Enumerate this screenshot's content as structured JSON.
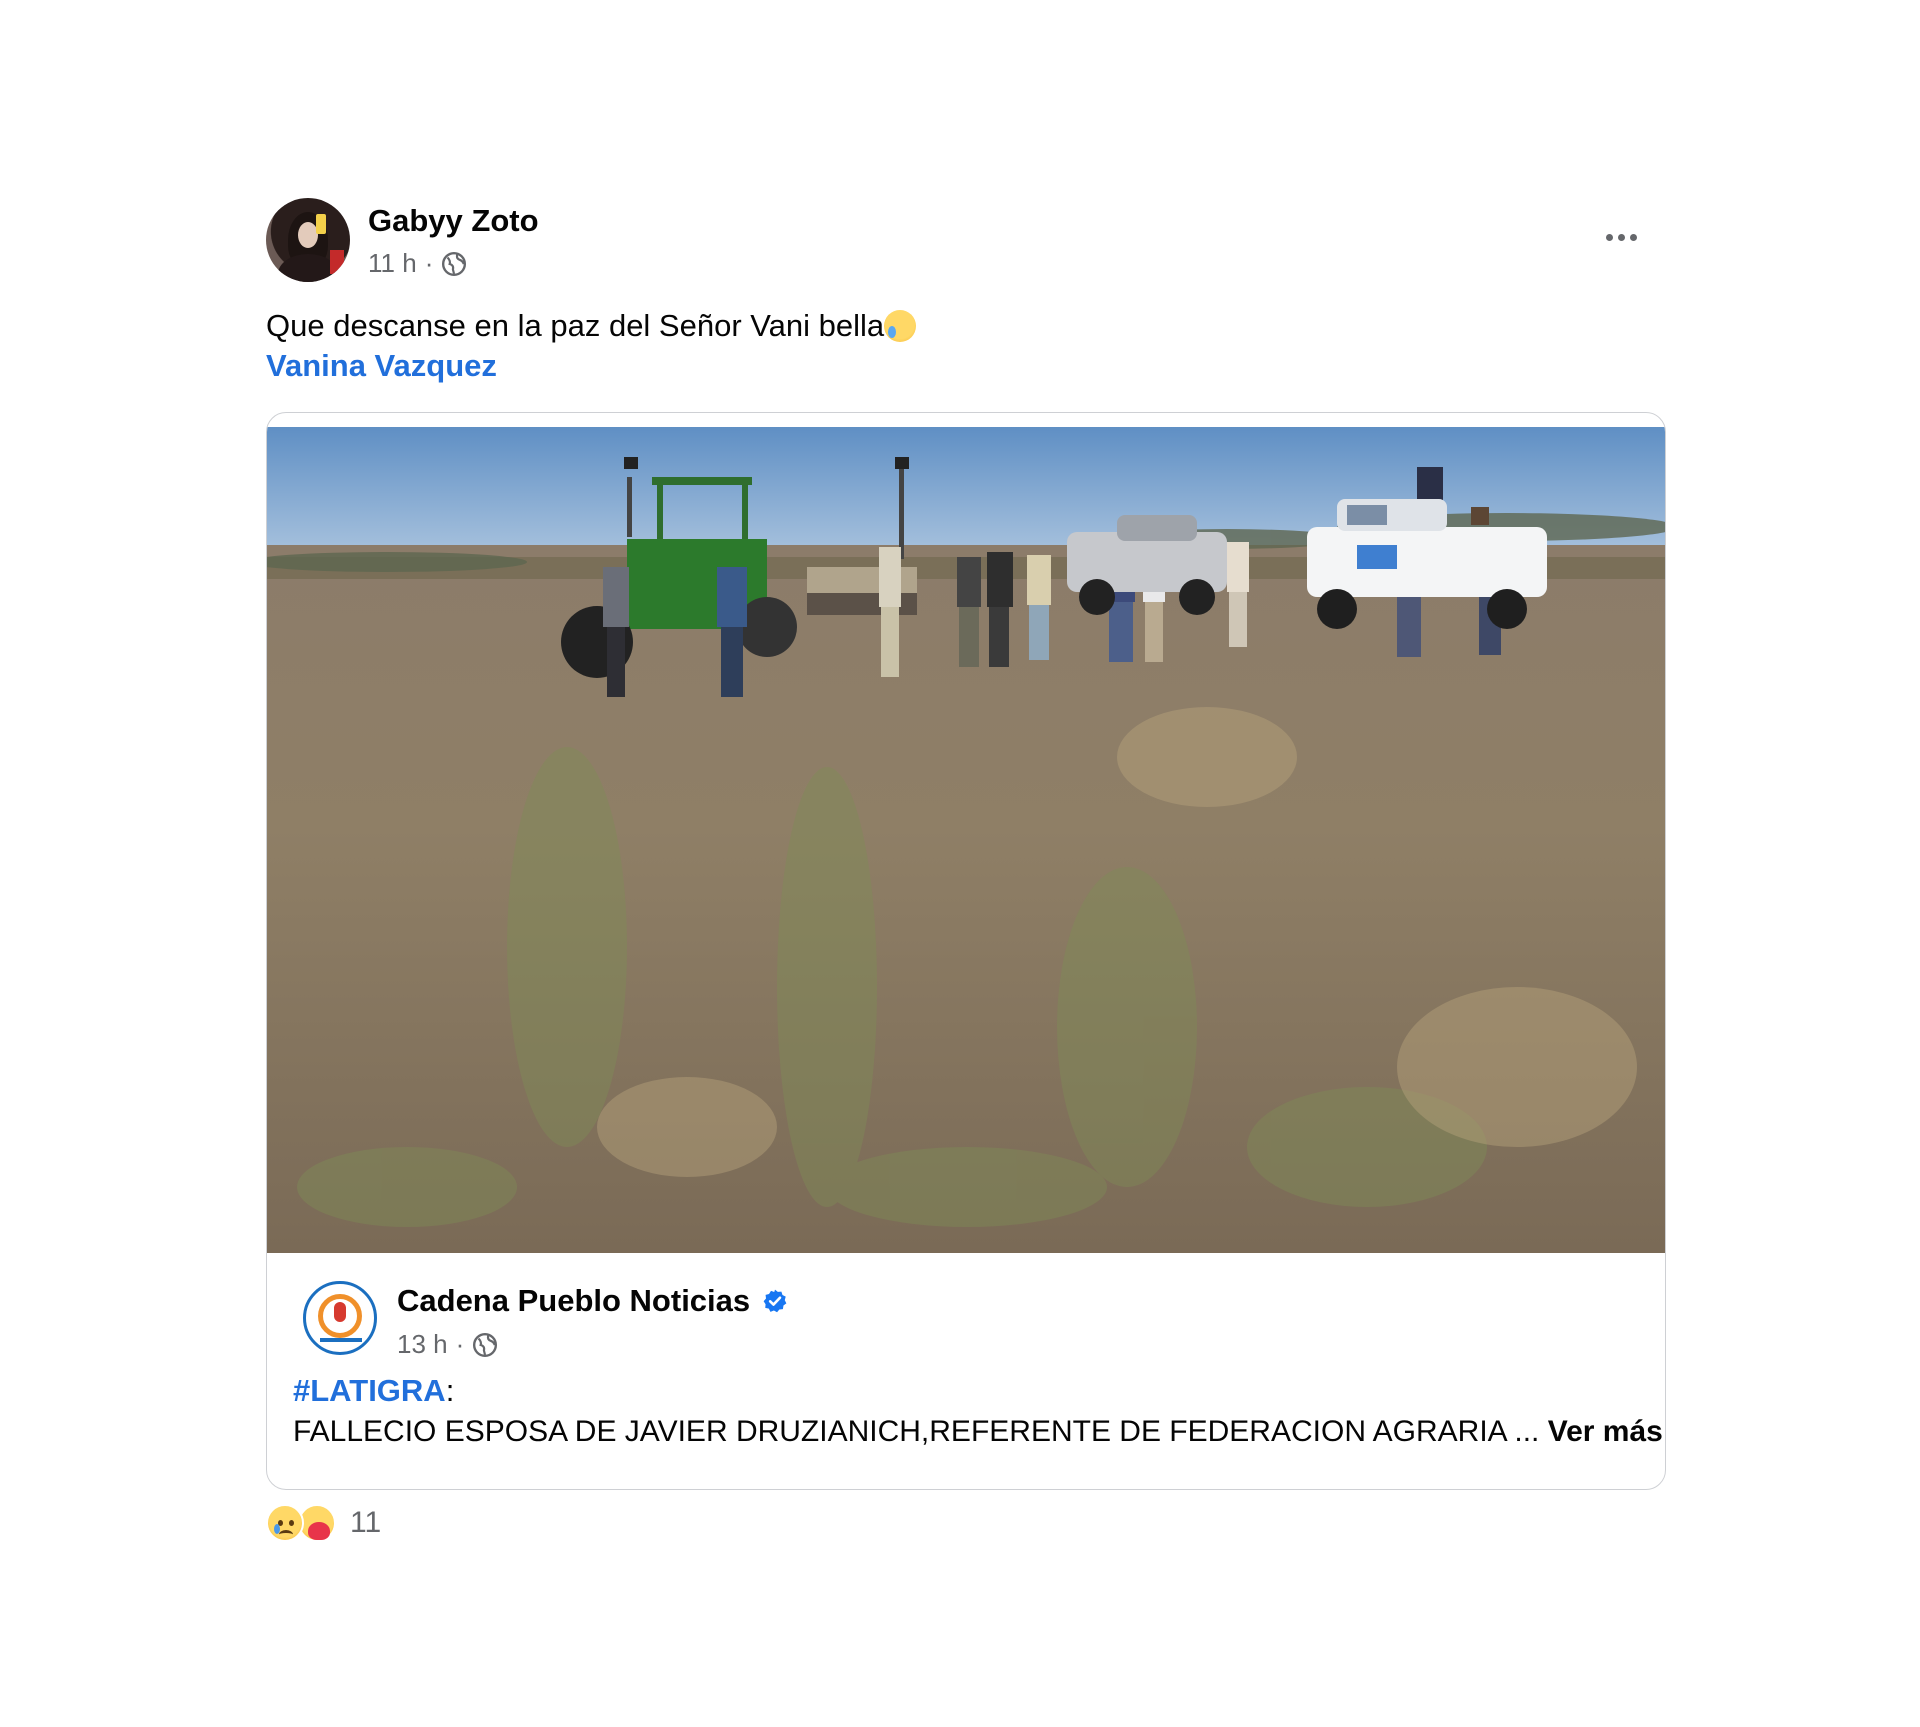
{
  "post": {
    "author": "Gabyy Zoto",
    "time": "11 h",
    "separator": "·",
    "audience_icon": "globe-icon",
    "text": "Que descanse en la paz del Señor Vani bella",
    "text_emoji": "crying-face-emoji",
    "mention": "Vanina Vazquez",
    "more_icon": "more-options-icon"
  },
  "shared": {
    "page_name": "Cadena Pueblo Noticias",
    "verified_icon": "verified-badge-icon",
    "time": "13 h",
    "separator": "·",
    "hashtag": "#LATIGRA",
    "hashtag_suffix": ":",
    "headline": "FALLECIO ESPOSA DE JAVIER DRUZIANICH,REFERENTE DE FEDERACION AGRARIA ... ",
    "see_more": "Ver más"
  },
  "reactions": {
    "icons": [
      "sad-reaction-icon",
      "care-reaction-icon"
    ],
    "count": "11"
  },
  "colors": {
    "link": "#216fdb",
    "secondary_text": "#65676b",
    "verified": "#1877f2"
  }
}
